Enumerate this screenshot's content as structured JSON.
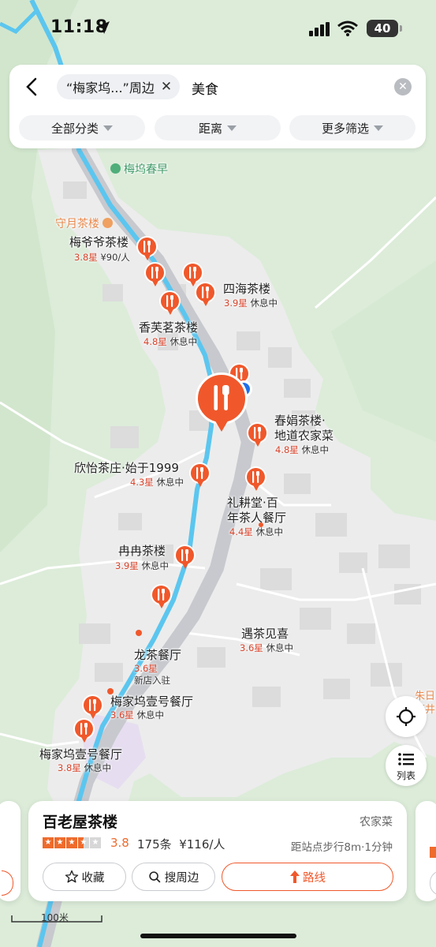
{
  "status": {
    "time": "11:18",
    "battery": "40"
  },
  "search": {
    "chip_label": "“梅家坞...”周边",
    "chip_close": "✕",
    "query": "美食"
  },
  "filters": [
    {
      "label": "全部分类"
    },
    {
      "label": "距离"
    },
    {
      "label": "更多筛选"
    }
  ],
  "map_labels": {
    "meiwuchunzao": "梅坞春早",
    "shouyue": "守月茶楼",
    "zhudizhi": "朱日\n茶井"
  },
  "pois": [
    {
      "name": "梅爷爷茶楼",
      "rating": "3.8星",
      "info": "¥90/人"
    },
    {
      "name": "四海茶楼",
      "rating": "3.9星",
      "info": "休息中"
    },
    {
      "name": "香芙茗茶楼",
      "rating": "4.8星",
      "info": "休息中"
    },
    {
      "name": "春娟茶楼·\n地道农家菜",
      "rating": "4.8星",
      "info": "休息中"
    },
    {
      "name": "欣怡茶庄·始于1999",
      "rating": "4.3星",
      "info": "休息中"
    },
    {
      "name": "礼耕堂·百\n年茶人餐厅",
      "rating": "4.4星",
      "info": "休息中"
    },
    {
      "name": "冉冉茶楼",
      "rating": "3.9星",
      "info": "休息中"
    },
    {
      "name": "遇茶见喜",
      "rating": "3.6星",
      "info": "休息中"
    },
    {
      "name": "龙茶餐厅",
      "rating": "3.6星",
      "info": "新店入驻"
    },
    {
      "name": "梅家坞壹号餐厅",
      "rating": "3.6星",
      "info": "休息中"
    },
    {
      "name": "梅家坞壹号餐厅",
      "rating": "3.8星",
      "info": "休息中"
    }
  ],
  "controls": {
    "list_label": "列表"
  },
  "card": {
    "title": "百老屋茶楼",
    "category": "农家菜",
    "rating": "3.8",
    "stars_value": 3.5,
    "reviews": "175条",
    "price": "¥116/人",
    "distance": "距站点步行8m·1分钟",
    "btn_collect": "收藏",
    "btn_nearby": "搜周边",
    "btn_route": "路线"
  },
  "scale": {
    "label": "100米"
  },
  "colors": {
    "accent": "#f0582b",
    "user": "#1f6fe8",
    "water": "#57c7f0",
    "land": "#dfeedd"
  }
}
